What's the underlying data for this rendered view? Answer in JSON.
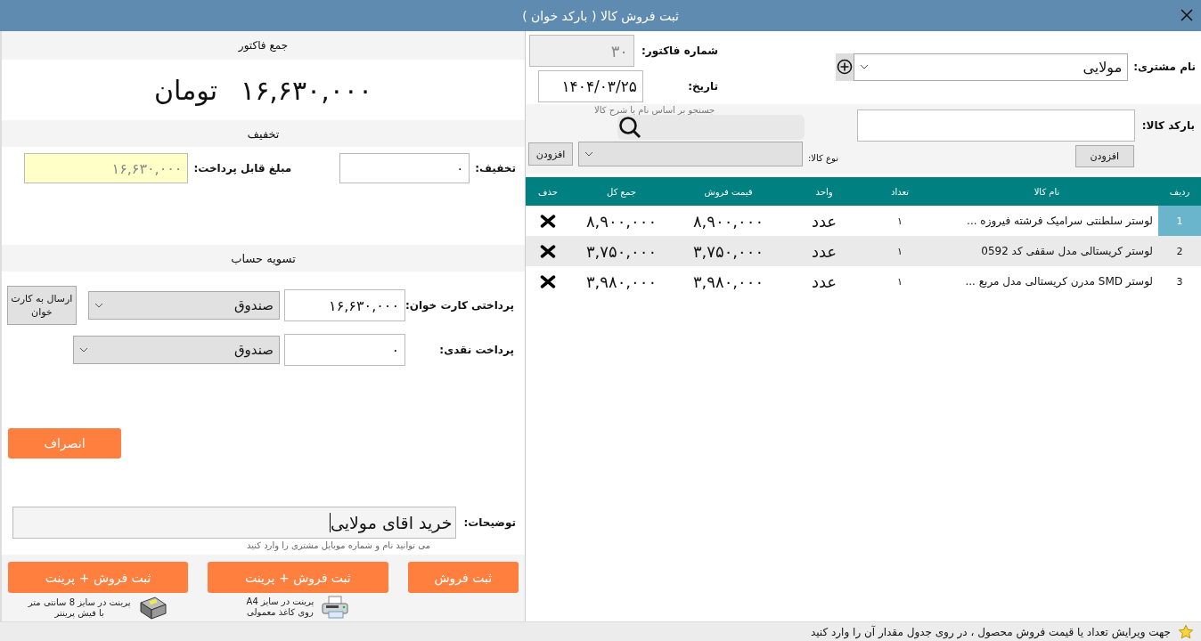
{
  "window": {
    "title": "ثبت فروش کالا ( بارکد خوان )"
  },
  "customer": {
    "label": "نام مشتری:",
    "value": "مولایی"
  },
  "invoice": {
    "number_label": "شماره فاکتور:",
    "number": "۳۰",
    "date_label": "تاریخ:",
    "date": "۱۴۰۴/۰۳/۲۵"
  },
  "barcode": {
    "label": "بارکد کالا:",
    "button": "افزودن"
  },
  "search": {
    "hint": "جستجو بر اساس نام یا شرح کالا"
  },
  "category": {
    "label": "نوع کالا:",
    "button": "افزودن"
  },
  "table": {
    "columns": [
      "ردیف",
      "نام کالا",
      "تعداد",
      "واحد",
      "قیمت فروش",
      "جمع کل",
      "حذف"
    ],
    "rows": [
      {
        "index": "1",
        "name": "لوستر سلطنتی سرامیک فرشته فیروزه ...",
        "qty": "۱",
        "unit": "عدد",
        "price": "۸,۹۰۰,۰۰۰",
        "total": "۸,۹۰۰,۰۰۰",
        "selected": true
      },
      {
        "index": "2",
        "name": "لوستر کریستالی مدل سقفی کد 0592",
        "qty": "۱",
        "unit": "عدد",
        "price": "۳,۷۵۰,۰۰۰",
        "total": "۳,۷۵۰,۰۰۰",
        "selected": false
      },
      {
        "index": "3",
        "name": "لوستر SMD مدرن کریستالی مدل مربع ...",
        "qty": "۱",
        "unit": "عدد",
        "price": "۳,۹۸۰,۰۰۰",
        "total": "۳,۹۸۰,۰۰۰",
        "selected": false
      }
    ]
  },
  "summary": {
    "title": "جمع فاکتور",
    "total": "۱۶,۶۳۰,۰۰۰",
    "currency": "تومان"
  },
  "discount": {
    "title": "تخفیف",
    "label": "تخفیف:",
    "value": "۰",
    "payable_label": "مبلغ قابل پرداخت:",
    "payable": "۱۶,۶۳۰,۰۰۰"
  },
  "settlement": {
    "title": "تسویه حساب",
    "send_button": "ارسال به کارت خوان",
    "rows": [
      {
        "label": "پرداختی کارت خوان:",
        "value": "۱۶,۶۳۰,۰۰۰",
        "account": "صندوق"
      },
      {
        "label": "پرداخت نقدی:",
        "value": "۰",
        "account": "صندوق"
      }
    ]
  },
  "cancel_button": "انصراف",
  "notes": {
    "label": "توضیحات:",
    "value": "خرید اقای مولایی",
    "hint": "می توانید نام و شماره موبایل مشتری را وارد کنید"
  },
  "actions": [
    {
      "label": "ثبت فروش",
      "kind": "plain"
    },
    {
      "label": "ثبت فروش + پرینت",
      "caption_1": "پرینت در سایز A4",
      "caption_2": "روی کاغذ معمولی",
      "kind": "a4"
    },
    {
      "label": "ثبت فروش + پرینت",
      "caption_1": "پرینت در سایز 8 سانتی متر",
      "caption_2": "با فیش پرینتر",
      "kind": "receipt"
    }
  ],
  "status_bar": {
    "text": "جهت ویرایش تعداد یا قیمت فروش محصول ، در روی جدول مقدار آن را وارد کنید"
  }
}
